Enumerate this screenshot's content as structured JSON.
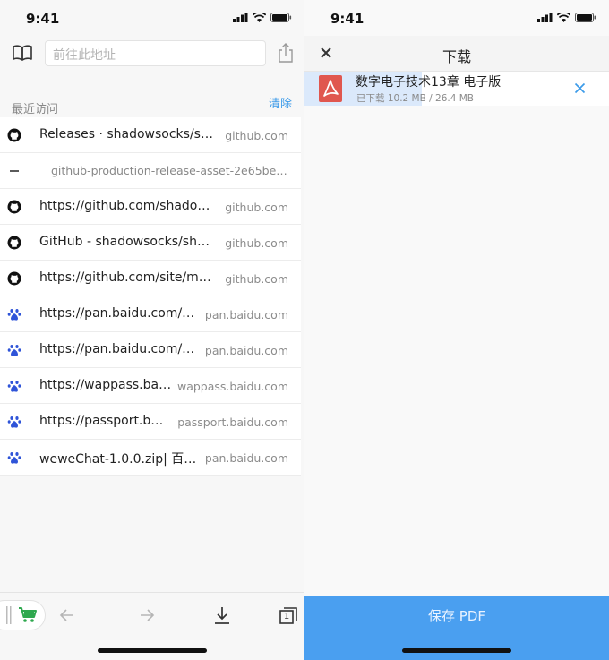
{
  "left": {
    "status": {
      "time": "9:41"
    },
    "address_placeholder": "前往此地址",
    "history": {
      "section_label": "最近访问",
      "clear_label": "清除",
      "items": [
        {
          "icon": "github-icon",
          "title": "Releases · shadowsocks/sh...",
          "domain": "github.com"
        },
        {
          "icon": "dash-icon",
          "title": "github-production-release-asset-2e65be.s...",
          "domain": ""
        },
        {
          "icon": "github-icon",
          "title": "https://github.com/shadows...",
          "domain": "github.com"
        },
        {
          "icon": "github-icon",
          "title": "GitHub - shadowsocks/shad...",
          "domain": "github.com"
        },
        {
          "icon": "github-icon",
          "title": "https://github.com/site/mobi...",
          "domain": "github.com"
        },
        {
          "icon": "baidu-paw-icon",
          "title": "https://pan.baidu.com/wa...",
          "domain": "pan.baidu.com"
        },
        {
          "icon": "baidu-paw-icon",
          "title": "https://pan.baidu.com/wa...",
          "domain": "pan.baidu.com"
        },
        {
          "icon": "baidu-paw-icon",
          "title": "https://wappass.baid...",
          "domain": "wappass.baidu.com"
        },
        {
          "icon": "baidu-paw-icon",
          "title": "https://passport.bai...",
          "domain": "passport.baidu.com"
        },
        {
          "icon": "baidu-paw-icon",
          "title": "weweChat-1.0.0.zip| 百度...",
          "domain": "pan.baidu.com"
        }
      ]
    },
    "toolbar_icons": [
      "cart-icon",
      "back-arrow-icon",
      "forward-arrow-icon",
      "download-icon",
      "tabs-icon"
    ],
    "tab_count": "1"
  },
  "right": {
    "status": {
      "time": "9:41"
    },
    "title": "下载",
    "download": {
      "name": "数字电子技术13章 电子版",
      "progress_text": "已下载 10.2 MB / 26.4 MB",
      "progress_fraction": 0.386
    },
    "save_label": "保存 PDF"
  },
  "colors": {
    "accent": "#3d9be9",
    "save_button": "#4a9ff0",
    "progress": "#dbe9fb",
    "pdf_red": "#e0574f"
  }
}
